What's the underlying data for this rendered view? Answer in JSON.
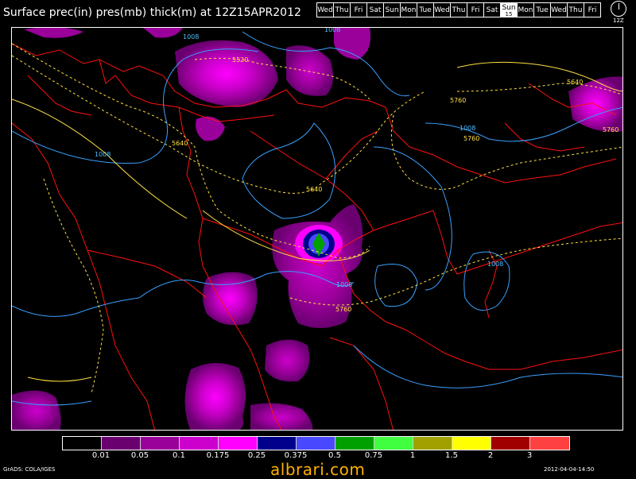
{
  "title": "Surface prec(in) pres(mb) thick(m) at 12Z15APR2012",
  "days": [
    {
      "label": "Wed",
      "active": false
    },
    {
      "label": "Thu",
      "active": false
    },
    {
      "label": "Fri",
      "active": false
    },
    {
      "label": "Sat",
      "active": false
    },
    {
      "label": "Sun",
      "active": false
    },
    {
      "label": "Mon",
      "active": false
    },
    {
      "label": "Tue",
      "active": false
    },
    {
      "label": "Wed",
      "active": false
    },
    {
      "label": "Thu",
      "active": false
    },
    {
      "label": "Fri",
      "active": false
    },
    {
      "label": "Sat",
      "active": false
    },
    {
      "label": "Sun",
      "sub": "15",
      "active": true
    },
    {
      "label": "Mon",
      "active": false
    },
    {
      "label": "Tue",
      "active": false
    },
    {
      "label": "Wed",
      "active": false
    },
    {
      "label": "Thu",
      "active": false
    },
    {
      "label": "Fri",
      "active": false
    }
  ],
  "clock_label": "12Z",
  "map": {
    "pressure_labels": [
      "1008",
      "1008",
      "1008",
      "1008",
      "1008",
      "1008"
    ],
    "thickness_labels": [
      "5520",
      "5640",
      "5640",
      "5640",
      "5760",
      "5760",
      "5760",
      "5760"
    ]
  },
  "legend": {
    "colors": [
      "#000000",
      "#6a0070",
      "#9a009a",
      "#cc00cc",
      "#ff00ff",
      "#00008c",
      "#4848ff",
      "#00a000",
      "#40ff40",
      "#a0a000",
      "#ffff00",
      "#a00000",
      "#ff4040"
    ],
    "labels": [
      "0.01",
      "0.05",
      "0.1",
      "0.175",
      "0.25",
      "0.375",
      "0.5",
      "0.75",
      "1",
      "1.5",
      "2",
      "3"
    ]
  },
  "credits": {
    "left": "GrADS: COLA/IGES",
    "right": "2012-04-04-14:50",
    "watermark": "albrari.com"
  }
}
